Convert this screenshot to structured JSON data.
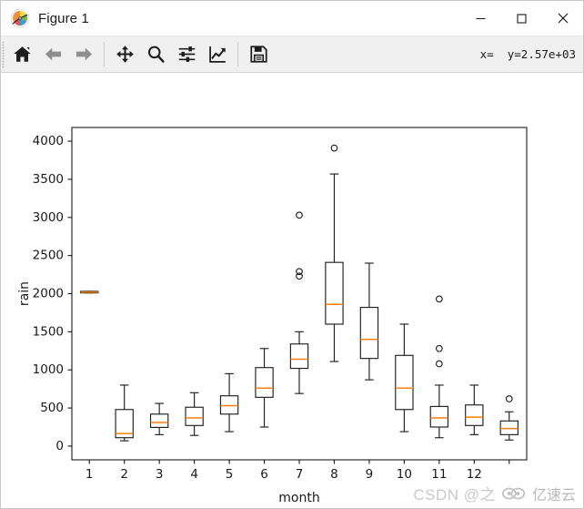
{
  "window": {
    "title": "Figure 1",
    "app_icon": "matplotlib-logo-icon",
    "minimize_label": "─",
    "maximize_label": "☐",
    "close_label": "✕"
  },
  "toolbar": {
    "buttons": [
      {
        "name": "home-button",
        "icon": "home-icon",
        "tooltip": "Reset original view"
      },
      {
        "name": "back-button",
        "icon": "arrow-left-icon",
        "tooltip": "Back to previous view"
      },
      {
        "name": "forward-button",
        "icon": "arrow-right-icon",
        "tooltip": "Forward to next view"
      },
      {
        "name": "pan-button",
        "icon": "move-arrows-icon",
        "tooltip": "Pan axes with left mouse, zoom with right"
      },
      {
        "name": "zoom-button",
        "icon": "magnifier-icon",
        "tooltip": "Zoom to rectangle"
      },
      {
        "name": "subplots-button",
        "icon": "sliders-icon",
        "tooltip": "Configure subplots"
      },
      {
        "name": "customize-button",
        "icon": "curve-chart-icon",
        "tooltip": "Edit axis, curve and image parameters"
      },
      {
        "name": "save-button",
        "icon": "floppy-disk-icon",
        "tooltip": "Save the figure"
      }
    ],
    "coordinate_readout": "x=  y=2.57e+03"
  },
  "watermark": {
    "csdn_text": "CSDN @之",
    "logo_text": "亿速云"
  },
  "chart_data": {
    "type": "boxplot",
    "title": "",
    "xlabel": "month",
    "ylabel": "rain",
    "xlim": [
      0.5,
      13.5
    ],
    "ylim": [
      -180,
      4180
    ],
    "yticks": [
      0,
      500,
      1000,
      1500,
      2000,
      2500,
      3000,
      3500,
      4000
    ],
    "ytick_labels": [
      "0",
      "500",
      "1000",
      "1500",
      "2000",
      "2500",
      "3000",
      "3500",
      "4000"
    ],
    "xticks": [
      1,
      2,
      3,
      4,
      5,
      6,
      7,
      8,
      9,
      10,
      11,
      12,
      13
    ],
    "xtick_labels": [
      "1",
      "2",
      "3",
      "4",
      "5",
      "6",
      "7",
      "8",
      "9",
      "10",
      "11",
      "12",
      ""
    ],
    "grid": false,
    "legend": null,
    "box_color": "#1f1f1f",
    "median_color": "#ff7f0e",
    "whisker_color": "#1f1f1f",
    "flier_color": "#1f1f1f",
    "boxes": [
      {
        "category": "1",
        "position": 1,
        "whisker_low": 2010,
        "q1": 2010,
        "median": 2020,
        "q3": 2030,
        "whisker_high": 2030,
        "outliers": []
      },
      {
        "category": "2",
        "position": 2,
        "whisker_low": 70,
        "q1": 110,
        "median": 165,
        "q3": 480,
        "whisker_high": 800,
        "outliers": []
      },
      {
        "category": "3",
        "position": 3,
        "whisker_low": 150,
        "q1": 245,
        "median": 310,
        "q3": 420,
        "whisker_high": 560,
        "outliers": []
      },
      {
        "category": "4",
        "position": 4,
        "whisker_low": 140,
        "q1": 270,
        "median": 370,
        "q3": 510,
        "whisker_high": 700,
        "outliers": []
      },
      {
        "category": "5",
        "position": 5,
        "whisker_low": 190,
        "q1": 420,
        "median": 530,
        "q3": 660,
        "whisker_high": 950,
        "outliers": []
      },
      {
        "category": "6",
        "position": 6,
        "whisker_low": 250,
        "q1": 640,
        "median": 760,
        "q3": 1030,
        "whisker_high": 1280,
        "outliers": []
      },
      {
        "category": "7",
        "position": 7,
        "whisker_low": 690,
        "q1": 1020,
        "median": 1140,
        "q3": 1340,
        "whisker_high": 1500,
        "outliers": [
          3030,
          2290,
          2230
        ]
      },
      {
        "category": "8",
        "position": 8,
        "whisker_low": 1110,
        "q1": 1600,
        "median": 1860,
        "q3": 2410,
        "whisker_high": 3570,
        "outliers": [
          3910
        ]
      },
      {
        "category": "9",
        "position": 9,
        "whisker_low": 870,
        "q1": 1150,
        "median": 1400,
        "q3": 1820,
        "whisker_high": 2400,
        "outliers": []
      },
      {
        "category": "10",
        "position": 10,
        "whisker_low": 190,
        "q1": 480,
        "median": 760,
        "q3": 1190,
        "whisker_high": 1600,
        "outliers": []
      },
      {
        "category": "11",
        "position": 11,
        "whisker_low": 110,
        "q1": 250,
        "median": 370,
        "q3": 520,
        "whisker_high": 800,
        "outliers": [
          1930,
          1280,
          1080
        ]
      },
      {
        "category": "12",
        "position": 12,
        "whisker_low": 150,
        "q1": 270,
        "median": 380,
        "q3": 540,
        "whisker_high": 800,
        "outliers": []
      },
      {
        "category": "",
        "position": 13,
        "whisker_low": 80,
        "q1": 150,
        "median": 230,
        "q3": 330,
        "whisker_high": 450,
        "outliers": [
          620
        ]
      }
    ]
  }
}
